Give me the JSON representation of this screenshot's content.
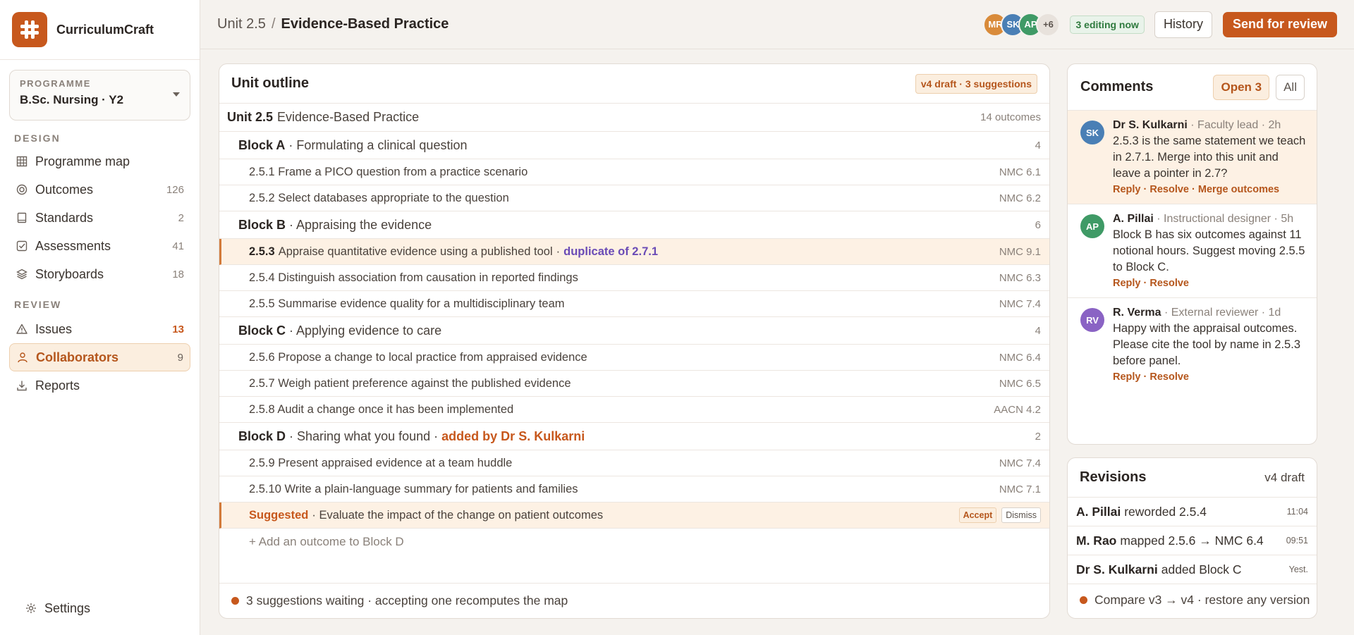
{
  "brand": {
    "name": "CurriculumCraft"
  },
  "programme": {
    "label": "PROGRAMME",
    "value": "B.Sc. Nursing · Y2"
  },
  "sidebar": {
    "design_label": "DESIGN",
    "design_items": [
      {
        "label": "Programme map",
        "count": "",
        "icon": "grid-icon"
      },
      {
        "label": "Outcomes",
        "count": "126",
        "icon": "target-icon"
      },
      {
        "label": "Standards",
        "count": "2",
        "icon": "book-icon"
      },
      {
        "label": "Assessments",
        "count": "41",
        "icon": "checkbox-icon"
      },
      {
        "label": "Storyboards",
        "count": "18",
        "icon": "layers-icon"
      }
    ],
    "review_label": "REVIEW",
    "review_items": [
      {
        "label": "Issues",
        "count": "13",
        "icon": "warning-icon"
      },
      {
        "label": "Collaborators",
        "count": "9",
        "icon": "user-icon"
      },
      {
        "label": "Reports",
        "count": "",
        "icon": "download-icon"
      }
    ],
    "settings_label": "Settings"
  },
  "header": {
    "breadcrumb_parent": "Unit 2.5",
    "breadcrumb_sep": "/",
    "breadcrumb_current": "Evidence-Based Practice",
    "avatars": [
      {
        "initials": "MR",
        "color": "#d98b3a"
      },
      {
        "initials": "SK",
        "color": "#4a7fb5"
      },
      {
        "initials": "AP",
        "color": "#3f9a66"
      }
    ],
    "avatars_more": "+6",
    "editing_now": "3 editing now",
    "history_label": "History",
    "send_label": "Send for review"
  },
  "outline": {
    "title": "Unit outline",
    "badge": "v4 draft · 3 suggestions",
    "unit": {
      "code": "Unit 2.5",
      "name": "Evidence-Based Practice",
      "count": "14 outcomes"
    },
    "blockA": {
      "code": "Block A",
      "name": "· Formulating a clinical question",
      "count": "4"
    },
    "o251": {
      "text": "2.5.1 Frame a PICO question from a practice scenario",
      "std": "NMC 6.1"
    },
    "o252": {
      "text": "2.5.2 Select databases appropriate to the question",
      "std": "NMC 6.2"
    },
    "blockB": {
      "code": "Block B",
      "name": "· Appraising the evidence",
      "count": "6"
    },
    "o253": {
      "code": "2.5.3",
      "text": "Appraise quantitative evidence using a published tool",
      "sep": "·",
      "flag": "duplicate of 2.7.1",
      "std": "NMC 9.1"
    },
    "o254": {
      "text": "2.5.4 Distinguish association from causation in reported findings",
      "std": "NMC 6.3"
    },
    "o255": {
      "text": "2.5.5 Summarise evidence quality for a multidisciplinary team",
      "std": "NMC 7.4"
    },
    "blockC": {
      "code": "Block C",
      "name": "· Applying evidence to care",
      "count": "4"
    },
    "o256": {
      "text": "2.5.6 Propose a change to local practice from appraised evidence",
      "std": "NMC 6.4"
    },
    "o257": {
      "text": "2.5.7 Weigh patient preference against the published evidence",
      "std": "NMC 6.5"
    },
    "o258": {
      "text": "2.5.8 Audit a change once it has been implemented",
      "std": "AACN 4.2"
    },
    "blockD": {
      "code": "Block D",
      "name": "· Sharing what you found",
      "sep": "·",
      "flag": "added by Dr S. Kulkarni",
      "count": "2"
    },
    "o259": {
      "text": "2.5.9 Present appraised evidence at a team huddle",
      "std": "NMC 7.4"
    },
    "o2510": {
      "text": "2.5.10 Write a plain-language summary for patients and families",
      "std": "NMC 7.1"
    },
    "suggestion": {
      "label": "Suggested",
      "text": "· Evaluate the impact of the change on patient outcomes",
      "accept": "Accept",
      "dismiss": "Dismiss"
    },
    "add_outcome": "+ Add an outcome to Block D",
    "footer": "3 suggestions waiting · accepting one recomputes the map"
  },
  "comments": {
    "title": "Comments",
    "tab_open": "Open 3",
    "tab_all": "All",
    "items": [
      {
        "initials": "SK",
        "color": "#4a7fb5",
        "author": "Dr S. Kulkarni",
        "meta": "· Faculty lead · 2h",
        "text": "2.5.3 is the same statement we teach in 2.7.1. Merge into this unit and leave a pointer in 2.7?",
        "actions": "Reply · Resolve · Merge outcomes"
      },
      {
        "initials": "AP",
        "color": "#3f9a66",
        "author": "A. Pillai",
        "meta": "· Instructional designer · 5h",
        "text": "Block B has six outcomes against 11 notional hours. Suggest moving 2.5.5 to Block C.",
        "actions": "Reply · Resolve"
      },
      {
        "initials": "RV",
        "color": "#8a63c4",
        "author": "R. Verma",
        "meta": "· External reviewer · 1d",
        "text": "Happy with the appraisal outcomes. Please cite the tool by name in 2.5.3 before panel.",
        "actions": "Reply · Resolve"
      }
    ]
  },
  "revisions": {
    "title": "Revisions",
    "version": "v4 draft",
    "items": [
      {
        "who": "A. Pillai",
        "what": "reworded 2.5.4",
        "time": "11:04"
      },
      {
        "who": "M. Rao",
        "what": "mapped 2.5.6 → NMC 6.4",
        "time": "09:51"
      },
      {
        "who": "Dr S. Kulkarni",
        "what": "added Block C",
        "time": "Yest."
      }
    ],
    "footer": "Compare v3 → v4 · restore any version"
  },
  "colors": {
    "accent": "#c7581d",
    "highlight": "#fdf1e4",
    "duplicate": "#6a4bb6",
    "success": "#2f7a3e"
  }
}
